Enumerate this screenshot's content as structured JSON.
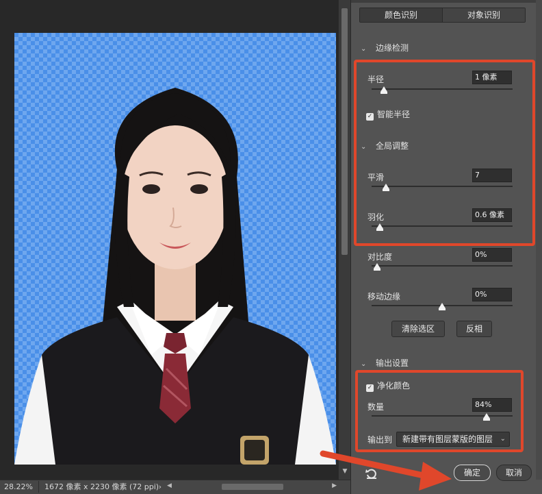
{
  "status_bar": {
    "zoom": "28.22%",
    "doc_info": "1672 像素 x 2230 像素 (72 ppi)",
    "doc_info_arrow": "›"
  },
  "panel": {
    "tabs": [
      {
        "label": "颜色识别"
      },
      {
        "label": "对象识别"
      }
    ],
    "edge_detection": {
      "title": "边缘检测",
      "radius_label": "半径",
      "radius_value": "1 像素",
      "radius_level": 0.05,
      "smart_radius_label": "智能半径",
      "smart_radius_checked": true
    },
    "global_adjust": {
      "title": "全局调整",
      "smooth_label": "平滑",
      "smooth_value": "7",
      "smooth_level": 0.07,
      "feather_label": "羽化",
      "feather_value": "0.6 像素",
      "feather_level": 0.02,
      "contrast_label": "对比度",
      "contrast_value": "0%",
      "contrast_level": 0.0,
      "shift_edge_label": "移动边缘",
      "shift_edge_value": "0%",
      "shift_edge_level": 0.5,
      "clear_selection_label": "清除选区",
      "invert_label": "反相"
    },
    "output": {
      "title": "输出设置",
      "decontaminate_label": "净化颜色",
      "decontaminate_checked": true,
      "amount_label": "数量",
      "amount_value": "84%",
      "amount_level": 0.84,
      "output_to_label": "输出到",
      "output_to_value": "新建带有图层蒙版的图层"
    },
    "ok_label": "确定",
    "cancel_label": "取消"
  },
  "colors": {
    "highlight": "#e0472b",
    "checker_a": "#4a8fe8",
    "checker_b": "#6ea7ef"
  }
}
